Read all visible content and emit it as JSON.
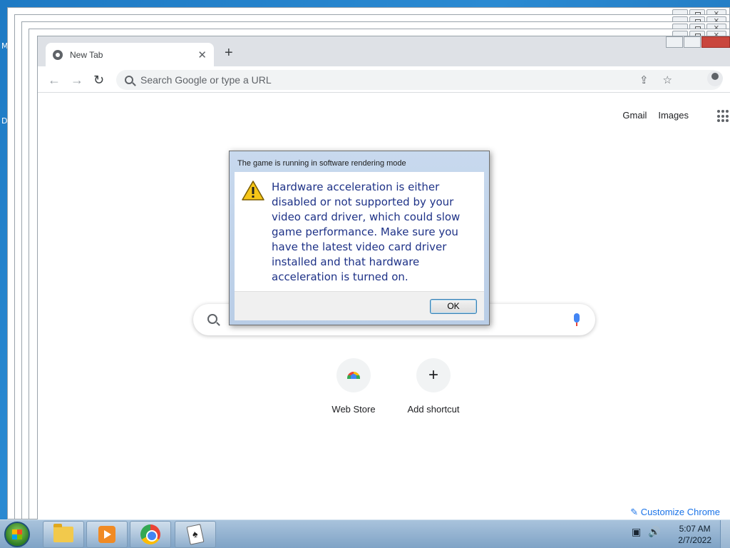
{
  "desktop": {
    "side_letters": [
      "M",
      "D"
    ]
  },
  "browser": {
    "tab_title": "New Tab",
    "newtab_symbol": "+",
    "tab_close_symbol": "✕",
    "omnibox_placeholder": "Search Google or type a URL",
    "back_symbol": "←",
    "forward_symbol": "→",
    "reload_symbol": "↻",
    "share_symbol": "⇪",
    "bookmark_symbol": "☆",
    "top_links": {
      "gmail": "Gmail",
      "images": "Images"
    },
    "customize_label": "Customize Chrome",
    "customize_symbol": "✎"
  },
  "shortcuts": [
    {
      "label": "Web Store",
      "icon": "web-store-icon"
    },
    {
      "label": "Add shortcut",
      "icon": "plus-icon",
      "symbol": "+"
    }
  ],
  "dialog": {
    "title": "The game is running in software rendering mode",
    "message": "Hardware acceleration is either disabled or not supported by your video card driver, which could slow game performance. Make sure you have the latest video card driver installed and that hardware acceleration is turned on.",
    "ok_label": "OK",
    "icon": "warning-icon"
  },
  "taskbar": {
    "pinned": [
      "file-explorer-icon",
      "media-player-icon",
      "chrome-icon",
      "solitaire-icon"
    ],
    "tray_network": "▣",
    "tray_volume": "🔊",
    "time": "5:07 AM",
    "date": "2/7/2022"
  }
}
